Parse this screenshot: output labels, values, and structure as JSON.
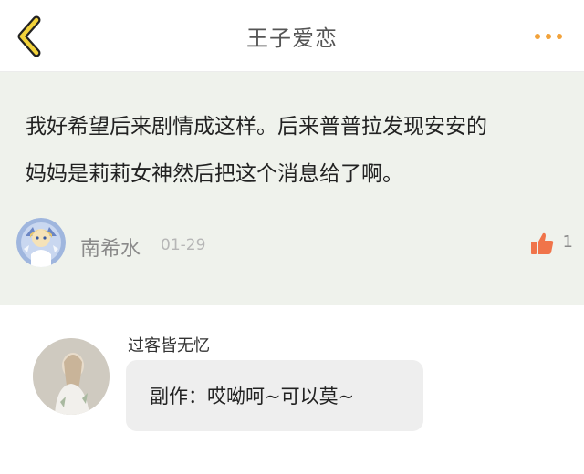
{
  "header": {
    "title": "王子爱恋",
    "back_icon": "chevron-left-icon",
    "more_icon": "more-dots-icon",
    "accent_color": "#f2a23a"
  },
  "featured_comment": {
    "line1": "我好希望后来剧情成这样。后来普普拉发现安安的",
    "line2": "妈妈是莉莉女神然后把这个消息给了啊。",
    "author": "南希水",
    "date": "01-29",
    "likes": "1",
    "like_icon": "thumbs-up-icon",
    "like_color": "#f0744a",
    "background": "#eff2ec"
  },
  "reply": {
    "author": "过客皆无忆",
    "text": "副作：哎呦呵~可以莫~",
    "bubble_color": "#eeeeee"
  }
}
